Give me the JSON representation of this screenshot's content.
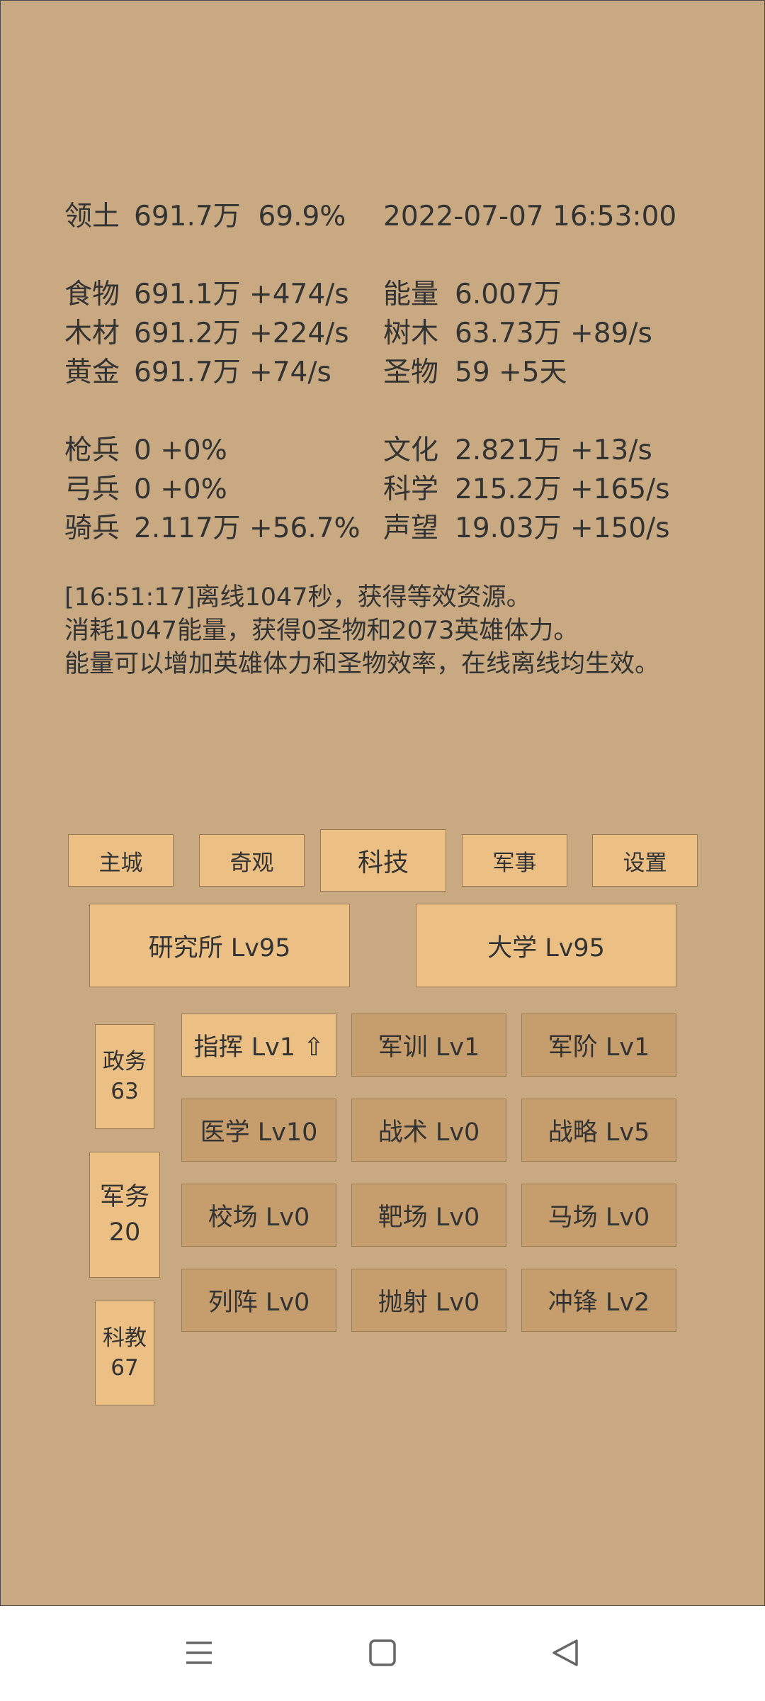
{
  "stats": {
    "territory": {
      "label": "领土",
      "value": "691.7万",
      "percent": "69.9%"
    },
    "datetime": "2022-07-07 16:53:00",
    "rows1": [
      {
        "label": "食物",
        "value": "691.1万 +474/s"
      },
      {
        "label": "木材",
        "value": "691.2万 +224/s"
      },
      {
        "label": "黄金",
        "value": "691.7万 +74/s"
      }
    ],
    "rows1_right": [
      {
        "label": "能量",
        "value": "6.007万"
      },
      {
        "label": "树木",
        "value": "63.73万 +89/s"
      },
      {
        "label": "圣物",
        "value": "59 +5天"
      }
    ],
    "rows2": [
      {
        "label": "枪兵",
        "value": "0 +0%"
      },
      {
        "label": "弓兵",
        "value": "0 +0%"
      },
      {
        "label": "骑兵",
        "value": "2.117万 +56.7%"
      }
    ],
    "rows2_right": [
      {
        "label": "文化",
        "value": "2.821万 +13/s"
      },
      {
        "label": "科学",
        "value": "215.2万 +165/s"
      },
      {
        "label": "声望",
        "value": "19.03万 +150/s"
      }
    ]
  },
  "log": [
    "[16:51:17]离线1047秒，获得等效资源。",
    "消耗1047能量，获得0圣物和2073英雄体力。",
    "能量可以增加英雄体力和圣物效率，在线离线均生效。"
  ],
  "tabs": [
    "主城",
    "奇观",
    "科技",
    "军事",
    "设置"
  ],
  "active_tab": "科技",
  "buildings": [
    "研究所 Lv95",
    "大学 Lv95"
  ],
  "categories": [
    {
      "name": "政务",
      "value": "63"
    },
    {
      "name": "军务",
      "value": "20"
    },
    {
      "name": "科教",
      "value": "67"
    }
  ],
  "techs": [
    [
      "指挥 Lv1 ⇧",
      "军训 Lv1",
      "军阶 Lv1"
    ],
    [
      "医学 Lv10",
      "战术 Lv0",
      "战略 Lv5"
    ],
    [
      "校场 Lv0",
      "靶场 Lv0",
      "马场 Lv0"
    ],
    [
      "列阵 Lv0",
      "抛射 Lv0",
      "冲锋 Lv2"
    ]
  ],
  "colors": {
    "background": "#c9a981",
    "button_light": "#ecc084",
    "button_dark": "#c69d6d",
    "text": "#333333"
  },
  "navbar_icons": [
    "menu-icon",
    "home-square-icon",
    "back-triangle-icon"
  ]
}
